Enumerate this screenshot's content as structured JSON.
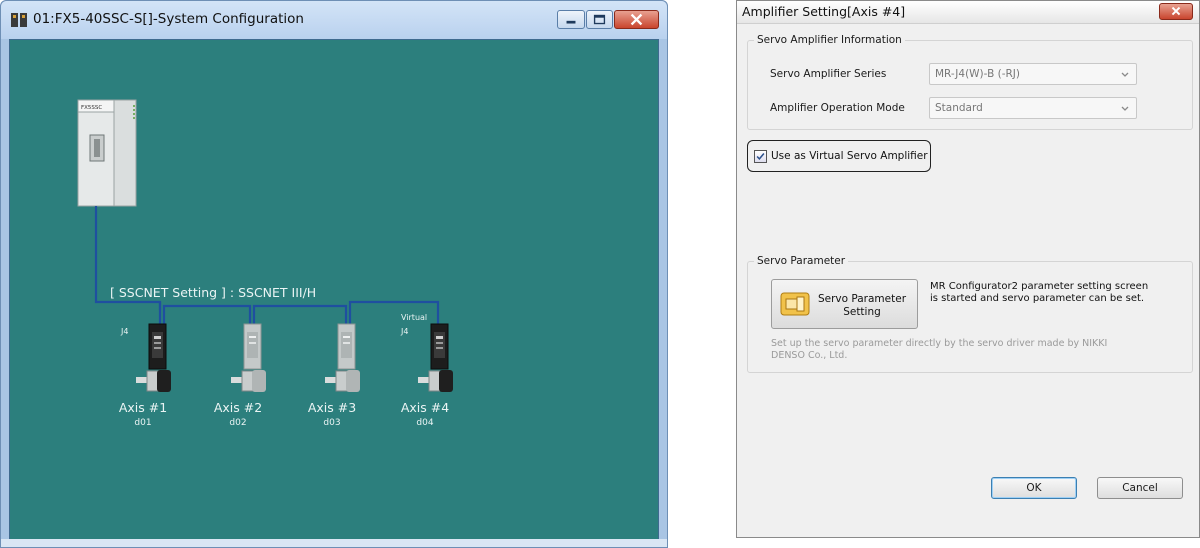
{
  "sysconfig": {
    "title": "01:FX5-40SSC-S[]-System Configuration",
    "module_label": "FX5SSC",
    "network_label": "[ SSCNET Setting ] : SSCNET III/H",
    "axes": [
      {
        "name": "Axis #1",
        "code": "d01",
        "tag": "J4",
        "virtual": false
      },
      {
        "name": "Axis #2",
        "code": "d02",
        "tag": "",
        "virtual": false
      },
      {
        "name": "Axis #3",
        "code": "d03",
        "tag": "",
        "virtual": false
      },
      {
        "name": "Axis #4",
        "code": "d04",
        "tag": "J4",
        "virtual": true
      }
    ],
    "virtual_tag": "Virtual",
    "colors": {
      "canvas": "#2c7f7d",
      "network_line": "#1f4fa0",
      "titlebar": "#c6dbf2"
    }
  },
  "dialog": {
    "title": "Amplifier Setting[Axis #4]",
    "info_group": "Servo Amplifier Information",
    "series_label": "Servo Amplifier Series",
    "series_value": "MR-J4(W)-B (-RJ)",
    "mode_label": "Amplifier Operation Mode",
    "mode_value": "Standard",
    "virtual_checkbox_label": "Use as Virtual Servo Amplifier",
    "virtual_checked": true,
    "param_group": "Servo Parameter",
    "param_button_line1": "Servo Parameter",
    "param_button_line2": "Setting",
    "param_desc_line1": "MR Configurator2 parameter setting screen",
    "param_desc_line2": "is started and servo parameter can be set.",
    "param_note_line1": "Set up the servo parameter directly by the servo driver made by NIKKI",
    "param_note_line2": "DENSO Co., Ltd.",
    "ok_label": "OK",
    "cancel_label": "Cancel"
  }
}
